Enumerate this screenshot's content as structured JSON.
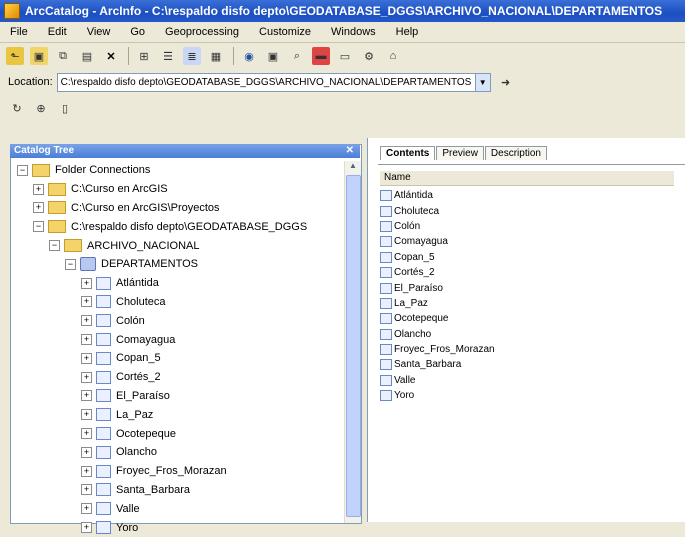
{
  "window": {
    "title": "ArcCatalog - ArcInfo - C:\\respaldo disfo depto\\GEODATABASE_DGGS\\ARCHIVO_NACIONAL\\DEPARTAMENTOS"
  },
  "menu": [
    "File",
    "Edit",
    "View",
    "Go",
    "Geoprocessing",
    "Customize",
    "Windows",
    "Help"
  ],
  "location": {
    "label": "Location:",
    "value": "C:\\respaldo disfo depto\\GEODATABASE_DGGS\\ARCHIVO_NACIONAL\\DEPARTAMENTOS"
  },
  "catalog_tree": {
    "title": "Catalog Tree",
    "close_glyph": "✕",
    "root": "Folder Connections",
    "connections": [
      "C:\\Curso en ArcGIS",
      "C:\\Curso en ArcGIS\\Proyectos",
      "C:\\respaldo disfo depto\\GEODATABASE_DGGS"
    ],
    "geodatabase": "ARCHIVO_NACIONAL",
    "dataset": "DEPARTAMENTOS",
    "items": [
      "Atlántida",
      "Choluteca",
      "Colón",
      "Comayagua",
      "Copan_5",
      "Cortés_2",
      "El_Paraíso",
      "La_Paz",
      "Ocotepeque",
      "Olancho",
      "Froyec_Fros_Morazan",
      "Santa_Barbara",
      "Valle",
      "Yoro"
    ]
  },
  "contents": {
    "tabs": [
      "Contents",
      "Preview",
      "Description"
    ],
    "column_header": "Name",
    "items": [
      "Atlántida",
      "Choluteca",
      "Colón",
      "Comayagua",
      "Copan_5",
      "Cortés_2",
      "El_Paraíso",
      "La_Paz",
      "Ocotepeque",
      "Olancho",
      "Froyec_Fros_Morazan",
      "Santa_Barbara",
      "Valle",
      "Yoro"
    ]
  },
  "toolbar_icons": [
    "up-one-level",
    "connect-folder",
    "copy",
    "paste",
    "delete",
    "large-icons",
    "list",
    "details",
    "thumbnails",
    "launch-arcmap",
    "catalog-window",
    "search",
    "toolbox",
    "python",
    "model-builder",
    "metadata"
  ],
  "expander_plus": "+",
  "expander_minus": "−"
}
